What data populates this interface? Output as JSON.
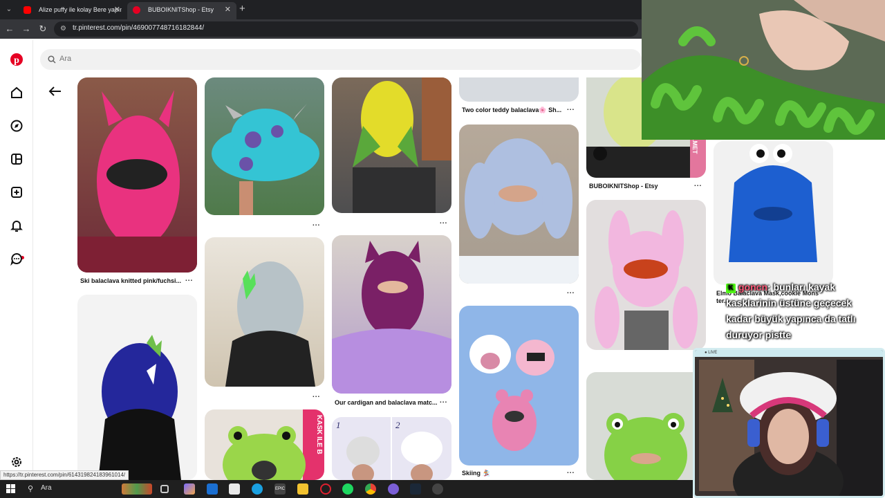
{
  "browser": {
    "tabs": [
      {
        "title": "Alize puffy ile kolay Bere yapımı",
        "favicon_color": "#ff0000",
        "active": false
      },
      {
        "title": "BUBOIKNITShop - Etsy",
        "favicon_color": "#e60023",
        "active": true
      }
    ],
    "new_tab_label": "+",
    "url": "tr.pinterest.com/pin/469007748716182844/"
  },
  "pinterest": {
    "search_placeholder": "Ara",
    "accent_color": "#e60023",
    "pins": [
      {
        "title": "Ski balaclava knitted pink/fuchsi...",
        "more": "..."
      },
      {
        "title": "",
        "more": "..."
      },
      {
        "title": "",
        "more": "..."
      },
      {
        "title": "Our cardigan and balaclava matc...",
        "more": "..."
      },
      {
        "title": "Two color teddy balaclava🌸 Sh...",
        "more": "..."
      },
      {
        "title": "",
        "more": "..."
      },
      {
        "title": "Skiing 🏂",
        "more": "..."
      },
      {
        "title": "BUBOIKNITShop - Etsy",
        "more": "..."
      },
      {
        "title": "Elmo Balaclava Mask,cookie Mons ter...",
        "more": "..."
      }
    ],
    "overlay_texts": {
      "kask_label": "KASK ILE B",
      "elmet_label": "ELMET"
    }
  },
  "stream": {
    "chat": {
      "username": "goncn",
      "message": ": bunları kayak kasklarinin üstüne geçecek kadar büyük yapınca da tatlı duruyor pistte"
    },
    "webcam_badge": "● LIVE"
  },
  "status_bar_url": "https://tr.pinterest.com/pin/614319824183961014/",
  "taskbar": {
    "search_label": "Ara"
  }
}
